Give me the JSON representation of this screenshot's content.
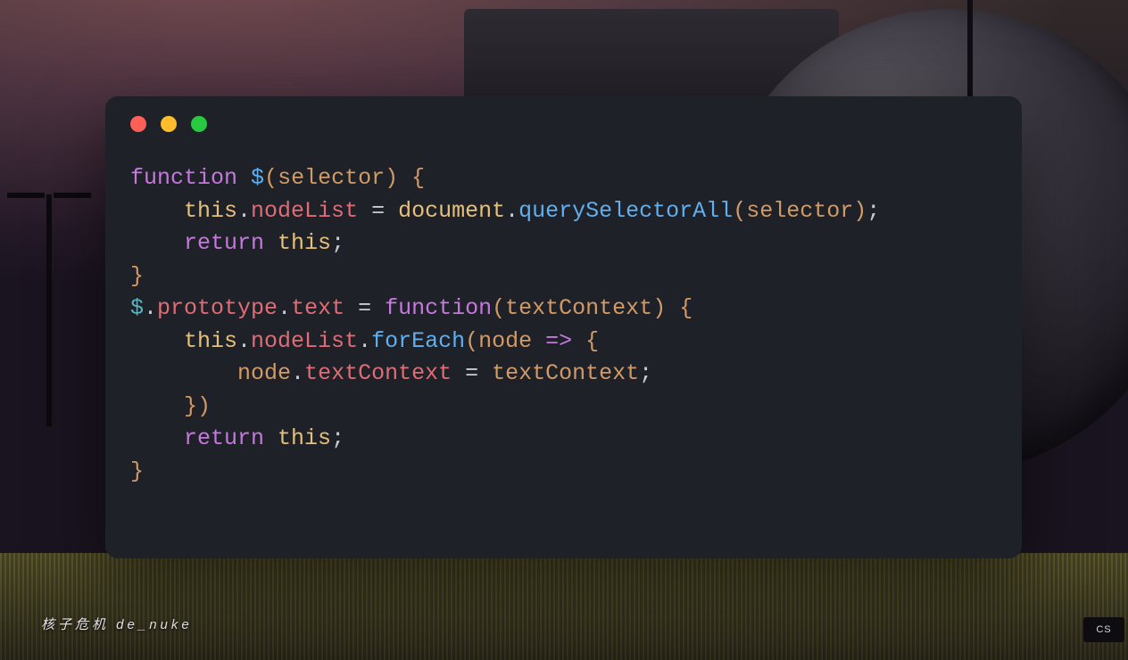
{
  "scene": {
    "caption": "核子危机 de_nuke",
    "logo": "CS"
  },
  "window": {
    "traffic_lights": [
      "red",
      "yellow",
      "green"
    ]
  },
  "code": {
    "lines": [
      [
        {
          "t": "function ",
          "c": "kw"
        },
        {
          "t": "$",
          "c": "fn"
        },
        {
          "t": "(",
          "c": "br"
        },
        {
          "t": "selector",
          "c": "param"
        },
        {
          "t": ") ",
          "c": "br"
        },
        {
          "t": "{",
          "c": "br"
        }
      ],
      [
        {
          "t": "    ",
          "c": "pn"
        },
        {
          "t": "this",
          "c": "obj"
        },
        {
          "t": ".",
          "c": "pn"
        },
        {
          "t": "nodeList",
          "c": "prop"
        },
        {
          "t": " = ",
          "c": "op"
        },
        {
          "t": "document",
          "c": "obj"
        },
        {
          "t": ".",
          "c": "pn"
        },
        {
          "t": "querySelectorAll",
          "c": "fn"
        },
        {
          "t": "(",
          "c": "br"
        },
        {
          "t": "selector",
          "c": "param"
        },
        {
          "t": ")",
          "c": "br"
        },
        {
          "t": ";",
          "c": "pn"
        }
      ],
      [
        {
          "t": "    ",
          "c": "pn"
        },
        {
          "t": "return ",
          "c": "kw"
        },
        {
          "t": "this",
          "c": "obj"
        },
        {
          "t": ";",
          "c": "pn"
        }
      ],
      [
        {
          "t": "}",
          "c": "br"
        }
      ],
      [
        {
          "t": "$",
          "c": "id"
        },
        {
          "t": ".",
          "c": "pn"
        },
        {
          "t": "prototype",
          "c": "prop"
        },
        {
          "t": ".",
          "c": "pn"
        },
        {
          "t": "text",
          "c": "prop"
        },
        {
          "t": " = ",
          "c": "op"
        },
        {
          "t": "function",
          "c": "kw"
        },
        {
          "t": "(",
          "c": "br"
        },
        {
          "t": "textContext",
          "c": "param"
        },
        {
          "t": ") ",
          "c": "br"
        },
        {
          "t": "{",
          "c": "br"
        }
      ],
      [
        {
          "t": "    ",
          "c": "pn"
        },
        {
          "t": "this",
          "c": "obj"
        },
        {
          "t": ".",
          "c": "pn"
        },
        {
          "t": "nodeList",
          "c": "prop"
        },
        {
          "t": ".",
          "c": "pn"
        },
        {
          "t": "forEach",
          "c": "fn"
        },
        {
          "t": "(",
          "c": "br"
        },
        {
          "t": "node",
          "c": "param"
        },
        {
          "t": " => ",
          "c": "kw"
        },
        {
          "t": "{",
          "c": "br"
        }
      ],
      [
        {
          "t": "        ",
          "c": "pn"
        },
        {
          "t": "node",
          "c": "param"
        },
        {
          "t": ".",
          "c": "pn"
        },
        {
          "t": "textContext",
          "c": "prop"
        },
        {
          "t": " = ",
          "c": "op"
        },
        {
          "t": "textContext",
          "c": "param"
        },
        {
          "t": ";",
          "c": "pn"
        }
      ],
      [
        {
          "t": "    ",
          "c": "pn"
        },
        {
          "t": "})",
          "c": "br"
        }
      ],
      [
        {
          "t": "    ",
          "c": "pn"
        },
        {
          "t": "return ",
          "c": "kw"
        },
        {
          "t": "this",
          "c": "obj"
        },
        {
          "t": ";",
          "c": "pn"
        }
      ],
      [
        {
          "t": "}",
          "c": "br"
        }
      ]
    ]
  }
}
